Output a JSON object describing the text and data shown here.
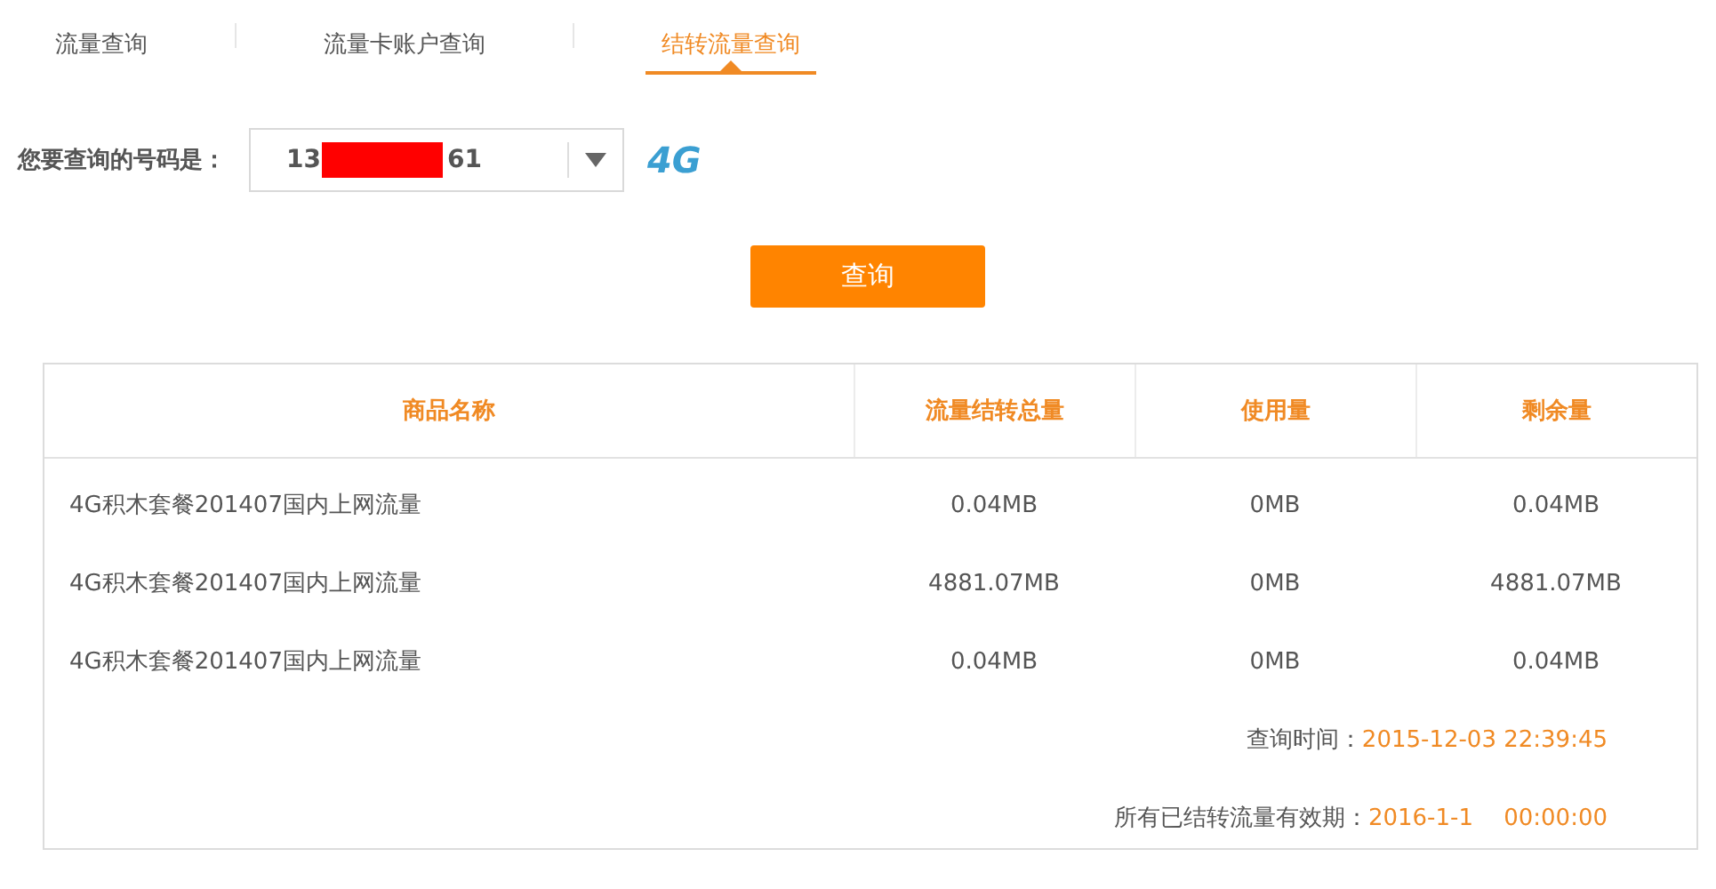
{
  "tabs": [
    {
      "label": "流量查询",
      "selected": false
    },
    {
      "label": "流量卡账户查询",
      "selected": false
    },
    {
      "label": "结转流量查询",
      "selected": true
    }
  ],
  "query": {
    "label": "您要查询的号码是：",
    "number_start": "13",
    "number_end": "61",
    "redacted": true,
    "network": "4G",
    "button": "查询"
  },
  "table": {
    "columns": [
      "商品名称",
      "流量结转总量",
      "使用量",
      "剩余量"
    ],
    "rows": [
      [
        "4G积木套餐201407国内上网流量",
        "0.04MB",
        "0MB",
        "0.04MB"
      ],
      [
        "4G积木套餐201407国内上网流量",
        "4881.07MB",
        "0MB",
        "4881.07MB"
      ],
      [
        "4G积木套餐201407国内上网流量",
        "0.04MB",
        "0MB",
        "0.04MB"
      ]
    ],
    "footer": [
      {
        "label": "查询时间：",
        "value": "2015-12-03 22:39:45"
      },
      {
        "label": "所有已结转流量有效期：",
        "value": "2016-1-1　 00:00:00"
      }
    ]
  }
}
